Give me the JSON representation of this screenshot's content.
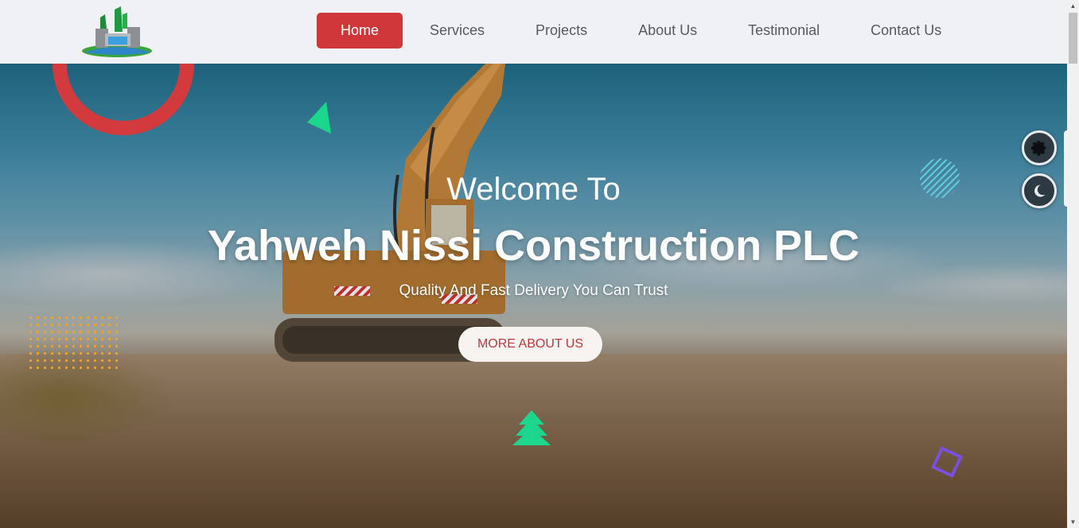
{
  "nav": {
    "items": [
      {
        "label": "Home",
        "active": true
      },
      {
        "label": "Services",
        "active": false
      },
      {
        "label": "Projects",
        "active": false
      },
      {
        "label": "About Us",
        "active": false
      },
      {
        "label": "Testimonial",
        "active": false
      },
      {
        "label": "Contact Us",
        "active": false
      }
    ]
  },
  "hero": {
    "welcome": "Welcome To",
    "title": "Yahweh Nissi Construction PLC",
    "subtitle": "Quality And Fast Delivery You Can Trust",
    "cta_label": "MORE ABOUT US"
  },
  "side_buttons": {
    "settings_icon": "gear-icon",
    "theme_icon": "moon-icon"
  },
  "colors": {
    "accent": "#d0373b",
    "nav_bg": "#f0f1f4",
    "ring": "#d23a3e",
    "green_shape": "#1dd68e",
    "purple_shape": "#7b4fe0",
    "dots": "#f0a32a",
    "hatch": "#5fc9dd"
  }
}
